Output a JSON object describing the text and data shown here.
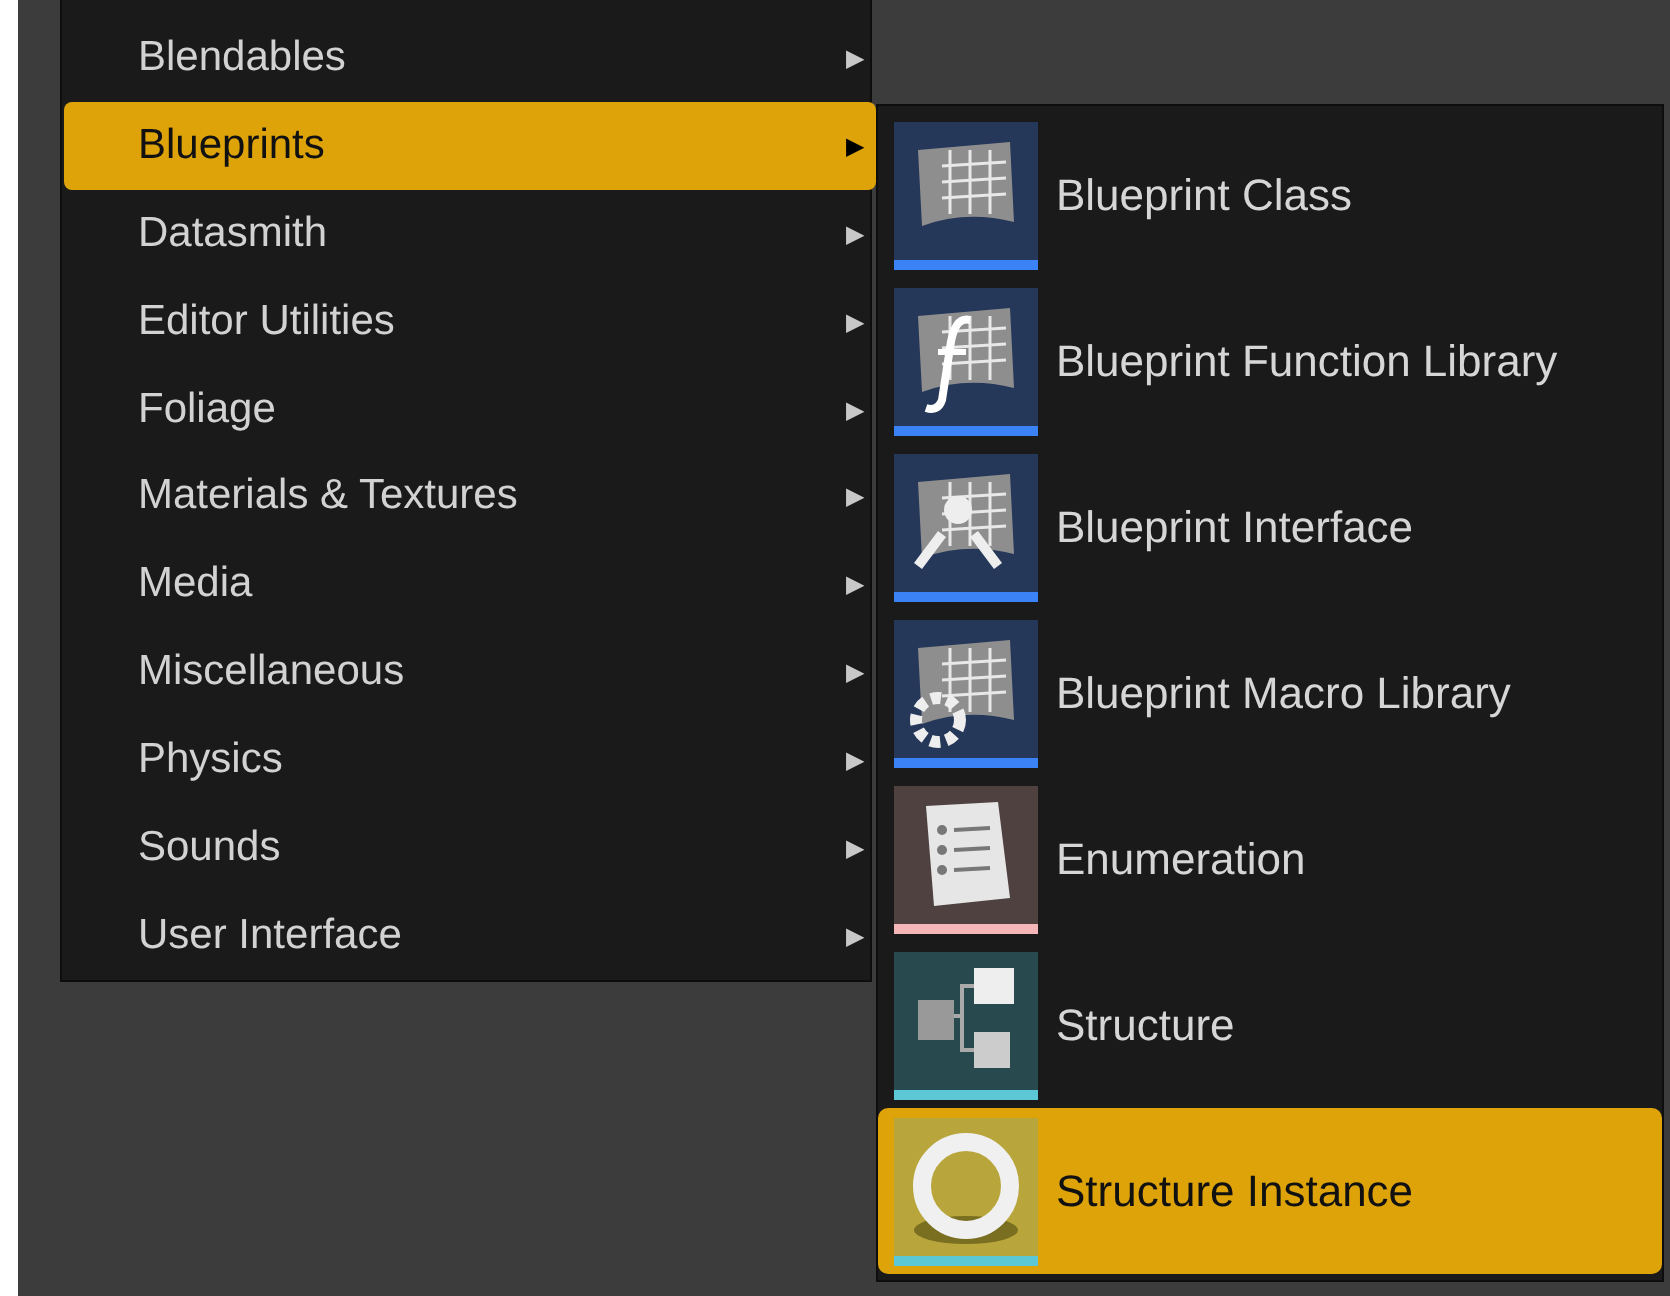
{
  "categories": [
    {
      "label": "Blendables",
      "selected": false,
      "arrow": "▶"
    },
    {
      "label": "Blueprints",
      "selected": true,
      "arrow": "▶"
    },
    {
      "label": "Datasmith",
      "selected": false,
      "arrow": "▶"
    },
    {
      "label": "Editor Utilities",
      "selected": false,
      "arrow": "▶"
    },
    {
      "label": "Foliage",
      "selected": false,
      "arrow": "▶"
    },
    {
      "label": "Materials & Textures",
      "selected": false,
      "arrow": "▶"
    },
    {
      "label": "Media",
      "selected": false,
      "arrow": "▶"
    },
    {
      "label": "Miscellaneous",
      "selected": false,
      "arrow": "▶"
    },
    {
      "label": "Physics",
      "selected": false,
      "arrow": "▶"
    },
    {
      "label": "Sounds",
      "selected": false,
      "arrow": "▶"
    },
    {
      "label": "User Interface",
      "selected": false,
      "arrow": "▶"
    }
  ],
  "submenu": [
    {
      "label": "Blueprint Class",
      "kind": "class",
      "color": "#3b82f6",
      "selected": false
    },
    {
      "label": "Blueprint Function Library",
      "kind": "function",
      "color": "#3b82f6",
      "selected": false
    },
    {
      "label": "Blueprint Interface",
      "kind": "interface",
      "color": "#3b82f6",
      "selected": false
    },
    {
      "label": "Blueprint Macro Library",
      "kind": "macro",
      "color": "#3b82f6",
      "selected": false
    },
    {
      "label": "Enumeration",
      "kind": "enum",
      "color": "#f4b6b6",
      "selected": false
    },
    {
      "label": "Structure",
      "kind": "struct",
      "color": "#5cc8d6",
      "selected": false
    },
    {
      "label": "Structure Instance",
      "kind": "instance",
      "color": "#5cc8d6",
      "selected": true
    }
  ]
}
